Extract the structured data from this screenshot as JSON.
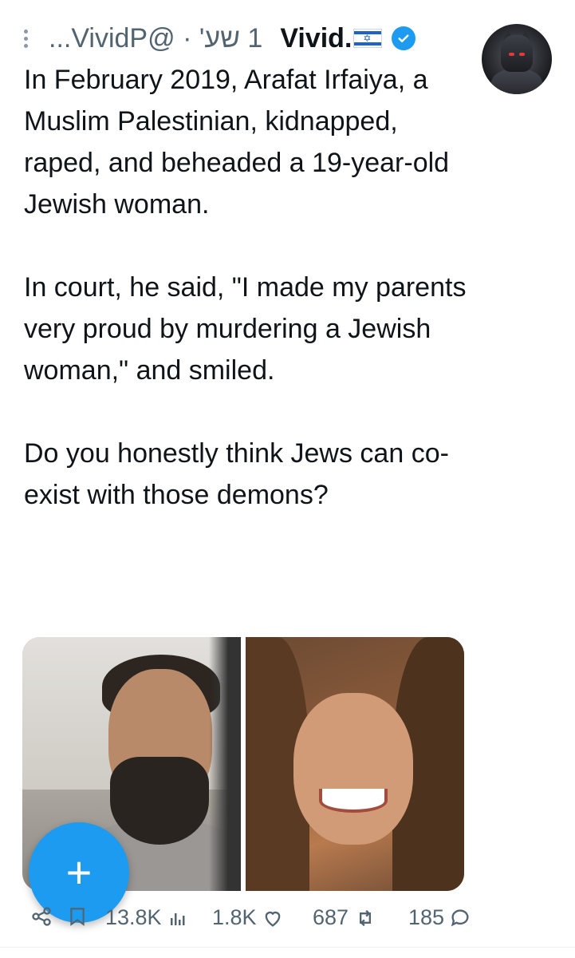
{
  "tweet": {
    "meta_text": "1 שע' · @VividP...",
    "display_name": "Vivid.",
    "verified": true,
    "paragraphs": [
      "In February 2019, Arafat Irfaiya, a Muslim Palestinian, kidnapped, raped, and beheaded a 19-year-old Jewish woman.",
      "In court, he said, \"I made my parents very proud by murdering a Jewish woman,\" and smiled.",
      "Do you honestly think Jews can co-exist with those demons?"
    ],
    "media": {
      "count": 2
    },
    "actions": {
      "views": "13.8K",
      "likes": "1.8K",
      "reposts": "687",
      "replies": "185"
    }
  },
  "fab": {
    "label": "+"
  },
  "colors": {
    "accent": "#1d9bf0",
    "text": "#0f1419",
    "muted": "#536471"
  },
  "icons": [
    "more-icon",
    "verified-badge-icon",
    "flag-icon",
    "share-icon",
    "bookmark-icon",
    "views-icon",
    "like-icon",
    "repost-icon",
    "reply-icon",
    "plus-icon"
  ]
}
